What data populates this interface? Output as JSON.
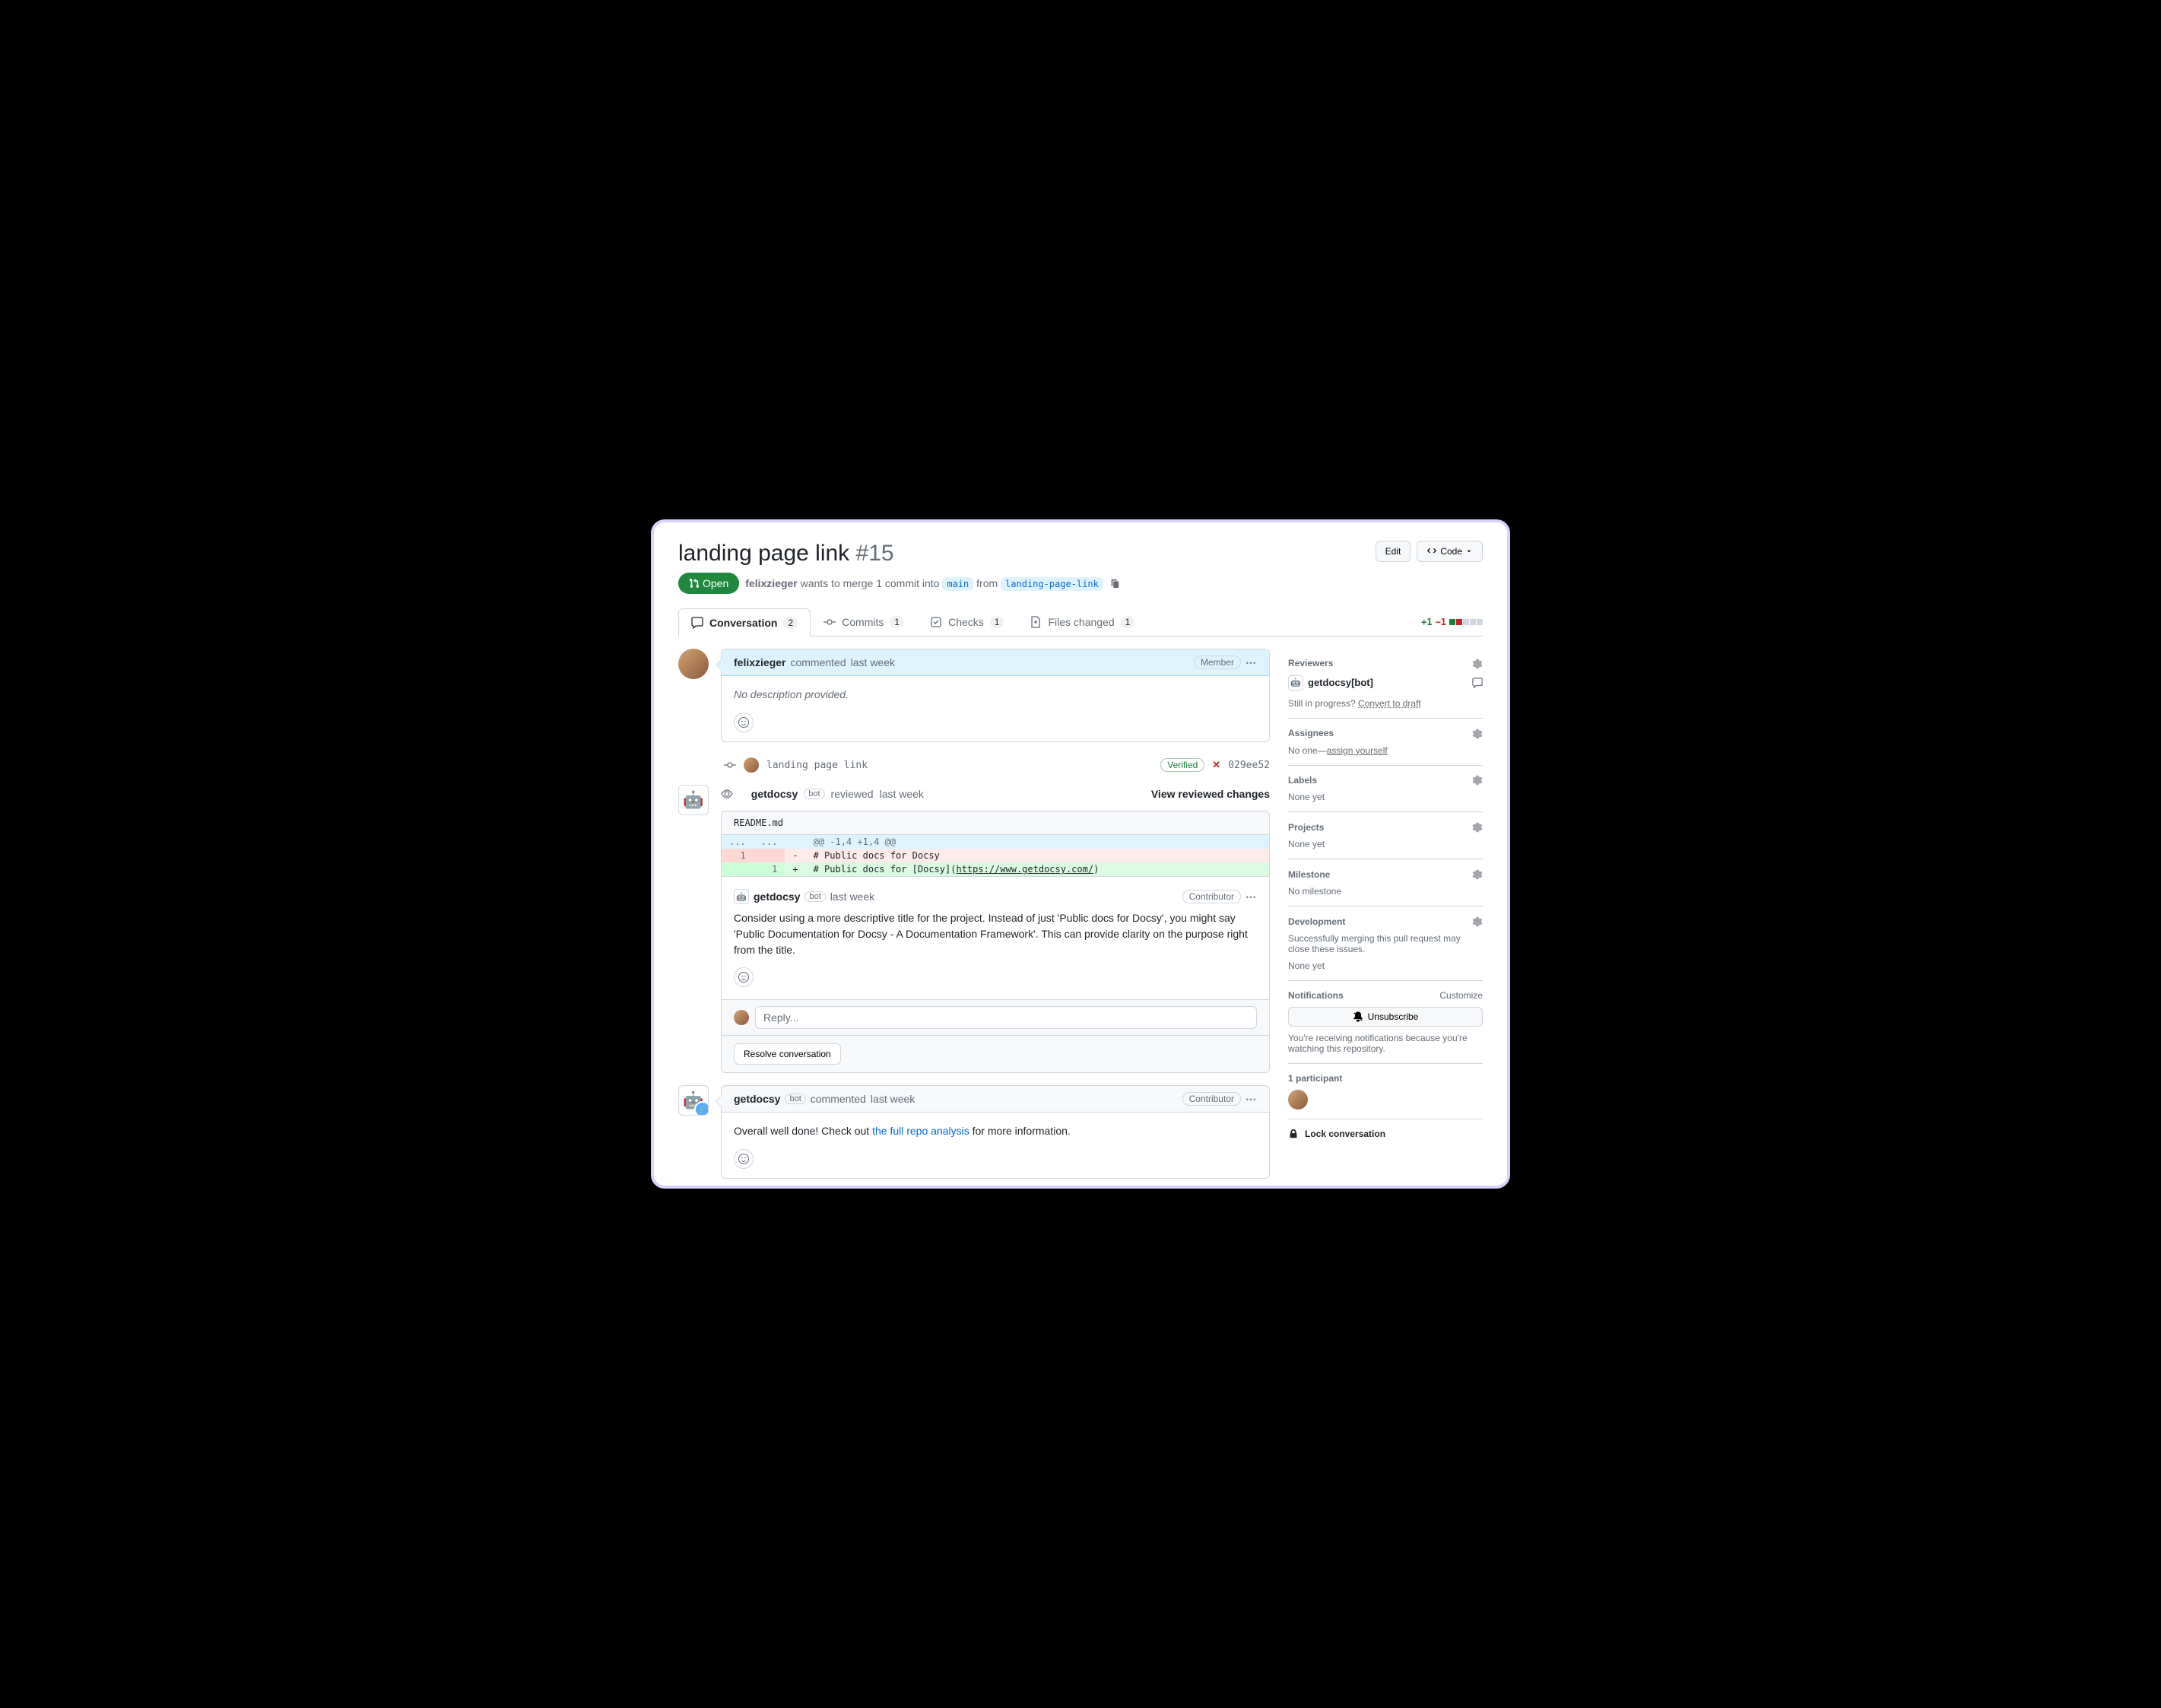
{
  "title": "landing page link",
  "issue_number": "#15",
  "header_buttons": {
    "edit": "Edit",
    "code": "Code"
  },
  "state": "Open",
  "meta": {
    "author": "felixzieger",
    "wants_text": " wants to merge 1 commit into ",
    "base_branch": "main",
    "from_text": " from ",
    "head_branch": "landing-page-link"
  },
  "tabs": [
    {
      "icon": "comment",
      "label": "Conversation",
      "count": "2",
      "active": true
    },
    {
      "icon": "commit",
      "label": "Commits",
      "count": "1"
    },
    {
      "icon": "check",
      "label": "Checks",
      "count": "1"
    },
    {
      "icon": "file",
      "label": "Files changed",
      "count": "1"
    }
  ],
  "diffstat": {
    "add": "+1",
    "del": "−1"
  },
  "comment1": {
    "author": "felixzieger",
    "action": " commented ",
    "time": "last week",
    "badge": "Member",
    "body": "No description provided."
  },
  "commit": {
    "message": "landing page link",
    "verified": "Verified",
    "sha": "029ee52"
  },
  "review": {
    "author": "getdocsy",
    "bot": "bot",
    "action": " reviewed ",
    "time": "last week",
    "view_link": "View reviewed changes",
    "file": "README.md",
    "hunk": "@@ -1,4 +1,4 @@",
    "del_ln": "1",
    "del_line": "# Public docs for Docsy",
    "add_ln": "1",
    "add_line_a": "# Public docs for ",
    "add_line_b": "[Docsy]",
    "add_line_c": "(",
    "add_line_link": "https://www.getdocsy.com/",
    "add_line_d": ")",
    "rc_author": "getdocsy",
    "rc_time": "last week",
    "rc_badge": "Contributor",
    "rc_body": "Consider using a more descriptive title for the project. Instead of just 'Public docs for Docsy', you might say 'Public Documentation for Docsy - A Documentation Framework'. This can provide clarity on the purpose right from the title.",
    "reply_placeholder": "Reply...",
    "resolve": "Resolve conversation"
  },
  "comment2": {
    "author": "getdocsy",
    "bot": "bot",
    "action": " commented ",
    "time": "last week",
    "badge": "Contributor",
    "body_a": "Overall well done! Check out ",
    "body_link": "the full repo analysis",
    "body_b": " for more information."
  },
  "sidebar": {
    "reviewers": {
      "title": "Reviewers",
      "name": "getdocsy[bot]",
      "draft_q": "Still in progress? ",
      "draft_link": "Convert to draft"
    },
    "assignees": {
      "title": "Assignees",
      "none": "No one—",
      "assign": "assign yourself"
    },
    "labels": {
      "title": "Labels",
      "body": "None yet"
    },
    "projects": {
      "title": "Projects",
      "body": "None yet"
    },
    "milestone": {
      "title": "Milestone",
      "body": "No milestone"
    },
    "development": {
      "title": "Development",
      "body": "Successfully merging this pull request may close these issues.",
      "none": "None yet"
    },
    "notifications": {
      "title": "Notifications",
      "customize": "Customize",
      "unsub": "Unsubscribe",
      "reason": "You're receiving notifications because you're watching this repository."
    },
    "participants": {
      "title": "1 participant"
    },
    "lock": "Lock conversation"
  }
}
